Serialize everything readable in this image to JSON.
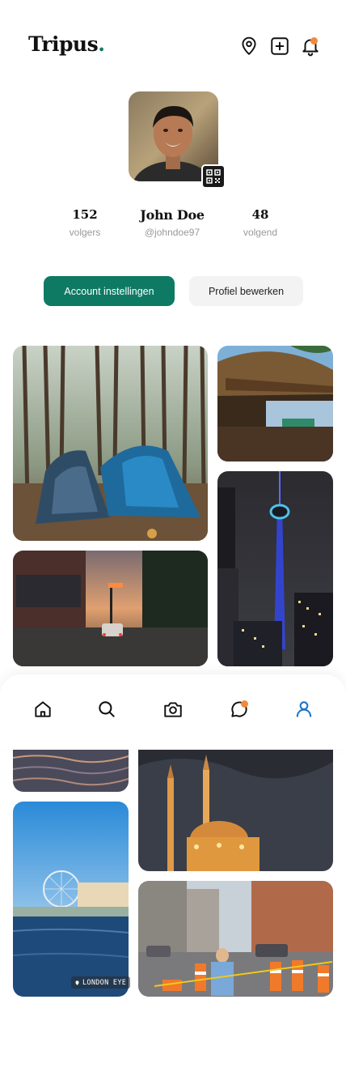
{
  "app": {
    "logo_text": "Tripus",
    "logo_dot": ".",
    "accent_color": "#0e7a64",
    "notification_color": "#f08a3c"
  },
  "header": {
    "icons": [
      "map-pin-icon",
      "add-post-icon",
      "bell-icon"
    ]
  },
  "profile": {
    "name": "John Doe",
    "handle": "@johndoe97",
    "followers_count": "152",
    "followers_label": "volgers",
    "following_count": "48",
    "following_label": "volgend"
  },
  "actions": {
    "account_settings_label": "Account instellingen",
    "edit_profile_label": "Profiel bewerken"
  },
  "gallery": {
    "photos": [
      "tents-in-forest",
      "beach-hut",
      "cn-tower-night",
      "traffic-sunset",
      "sea-waves",
      "mosque-dusk",
      "london-eye",
      "city-street-construction"
    ],
    "location_tag": "LONDON EYE"
  },
  "bottom_nav": {
    "items": [
      "home-icon",
      "search-icon",
      "camera-icon",
      "chat-icon",
      "profile-icon"
    ],
    "active": "profile-icon",
    "active_color": "#1b74c9"
  }
}
